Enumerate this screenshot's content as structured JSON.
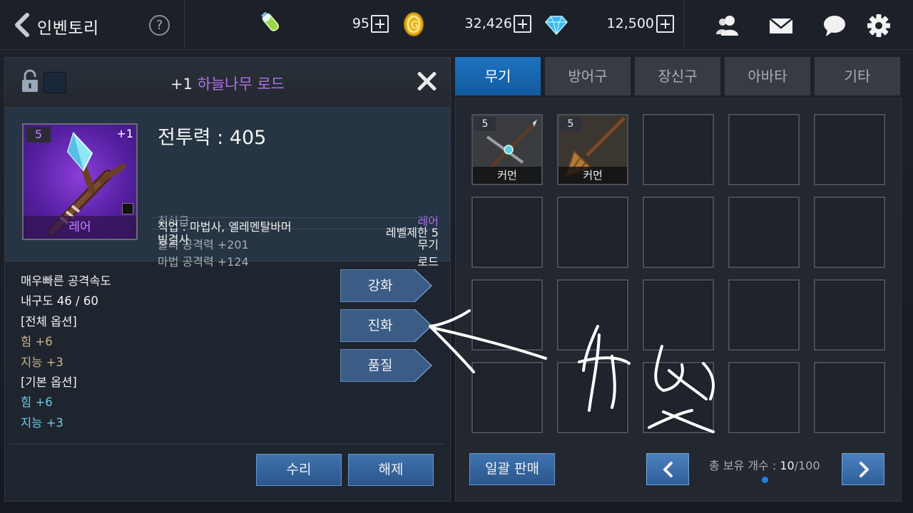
{
  "topbar": {
    "title": "인벤토리",
    "help": "?",
    "stamina": "95",
    "gold": "32,426",
    "gems": "12,500",
    "icons": [
      "back-arrow-icon",
      "help-icon",
      "stamina-potion-icon",
      "gold-coin-icon",
      "diamond-icon",
      "friends-icon",
      "mail-icon",
      "chat-icon",
      "settings-gear-icon"
    ]
  },
  "detail": {
    "title_level": "+1",
    "title_name": "하늘나무 로드",
    "icon_number": "5",
    "icon_enhance": "+1",
    "icon_grade": "레어",
    "power_label": "전투력 : 405",
    "quality": "최하급",
    "grade": "레어",
    "phys_atk": "물리 공격력 +201",
    "magic_atk": "마법 공격력 +124",
    "type": "무기",
    "subtype": "로드",
    "job_line1": "직업 : 마법사, 엘레멘탈바머",
    "job_line2": "빙결사",
    "level_limit": "레벨제한 5",
    "options": {
      "speed": "매우빠른 공격속도",
      "durability": "내구도 46 / 60",
      "all_header": "[전체 옵션]",
      "all_str": "힘 +6",
      "all_int": "지능 +3",
      "base_header": "[기본 옵션]",
      "base_str": "힘 +6",
      "base_int": "지능 +3"
    },
    "buttons": {
      "enhance": "강화",
      "evolve": "진화",
      "quality": "품질",
      "repair": "수리",
      "unequip": "해제"
    }
  },
  "inventory": {
    "tabs": [
      "무기",
      "방어구",
      "장신구",
      "아바타",
      "기타"
    ],
    "active_tab": 0,
    "items": [
      {
        "number": "5",
        "caption": "커먼",
        "icon": "crossed-spear-icon"
      },
      {
        "number": "5",
        "caption": "커먼",
        "icon": "broom-staff-icon"
      }
    ],
    "bulk_sell": "일괄 판매",
    "count_label": "총 보유 개수 : ",
    "count_value": "10",
    "count_max": "/100"
  },
  "colors": {
    "accent_blue": "#1d73c0",
    "rare_purple": "#b26ef0",
    "option_gold": "#c9b48c",
    "option_cyan": "#67cce6"
  }
}
